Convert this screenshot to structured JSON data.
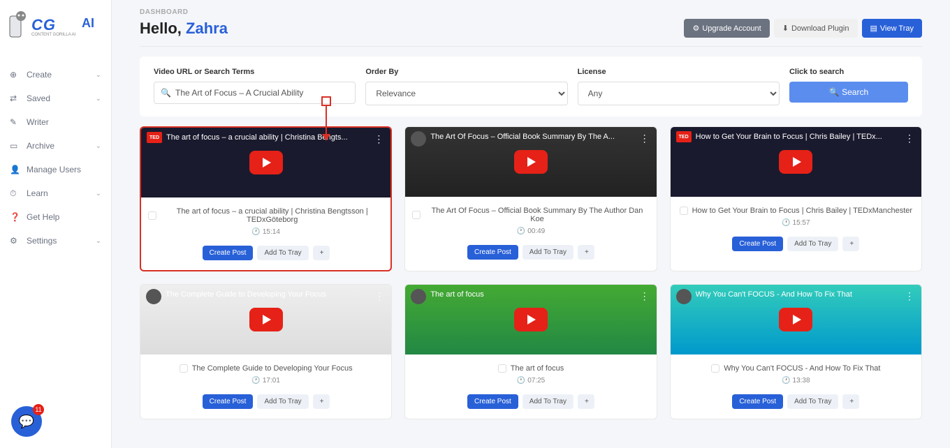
{
  "breadcrumb": "DASHBOARD",
  "hello_prefix": "Hello, ",
  "hello_name": "Zahra",
  "header_buttons": {
    "upgrade": "Upgrade Account",
    "download": "Download Plugin",
    "view_tray": "View Tray"
  },
  "search": {
    "url_label": "Video URL or Search Terms",
    "url_value": "The Art of Focus – A Crucial Ability",
    "order_label": "Order By",
    "order_value": "Relevance",
    "license_label": "License",
    "license_value": "Any",
    "click_label": "Click to search",
    "search_btn": "Search"
  },
  "sidebar": {
    "items": [
      {
        "label": "Create",
        "chevron": true
      },
      {
        "label": "Saved",
        "chevron": true
      },
      {
        "label": "Writer",
        "chevron": false
      },
      {
        "label": "Archive",
        "chevron": true
      },
      {
        "label": "Manage Users",
        "chevron": false
      },
      {
        "label": "Learn",
        "chevron": true
      },
      {
        "label": "Get Help",
        "chevron": false
      },
      {
        "label": "Settings",
        "chevron": true
      }
    ]
  },
  "card_actions": {
    "create": "Create Post",
    "tray": "Add To Tray",
    "plus": "+"
  },
  "videos": [
    {
      "thumb_title": "The art of focus – a crucial ability | Christina Bengts...",
      "title": "The art of focus – a crucial ability | Christina Bengtsson | TEDxGöteborg",
      "duration": "15:14",
      "logo": "TED",
      "highlighted": true,
      "bg": ""
    },
    {
      "thumb_title": "The Art Of Focus – Official Book Summary By The A...",
      "title": "The Art Of Focus – Official Book Summary By The Author Dan Koe",
      "duration": "00:49",
      "logo": "",
      "highlighted": false,
      "bg": "focus"
    },
    {
      "thumb_title": "How to Get Your Brain to Focus | Chris Bailey | TEDx...",
      "title": "How to Get Your Brain to Focus | Chris Bailey | TEDxManchester",
      "duration": "15:57",
      "logo": "TED",
      "highlighted": false,
      "bg": ""
    },
    {
      "thumb_title": "The Complete Guide to Developing Your Focus",
      "title": "The Complete Guide to Developing Your Focus",
      "duration": "17:01",
      "logo": "",
      "highlighted": false,
      "bg": "guide"
    },
    {
      "thumb_title": "The art of focus",
      "title": "The art of focus",
      "duration": "07:25",
      "logo": "",
      "highlighted": false,
      "bg": "artof"
    },
    {
      "thumb_title": "Why You Can't FOCUS - And How To Fix That",
      "title": "Why You Can't FOCUS - And How To Fix That",
      "duration": "13:38",
      "logo": "",
      "highlighted": false,
      "bg": "cartoon"
    }
  ],
  "chat_badge": "11",
  "logo": {
    "main": "CG",
    "ai": "AI",
    "sub": "CONTENT GORILLA AI"
  }
}
